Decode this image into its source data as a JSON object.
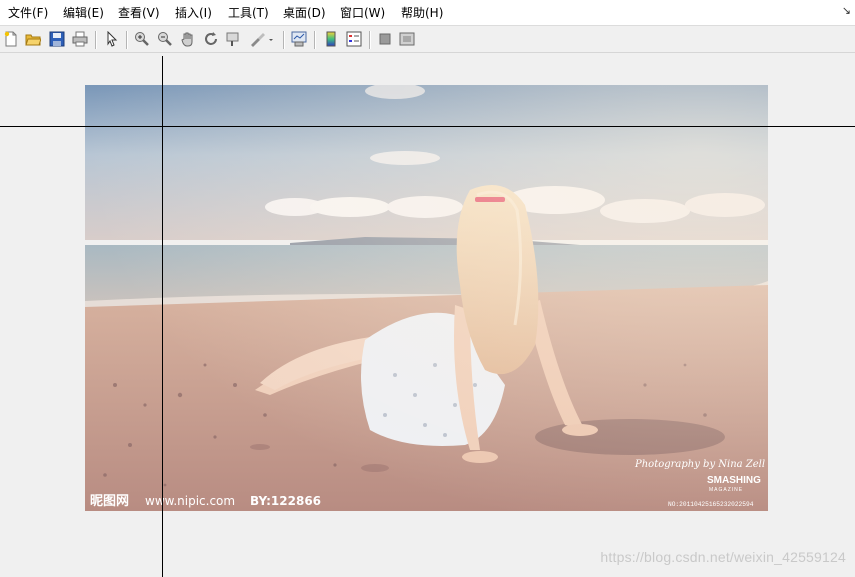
{
  "menubar": {
    "items": [
      "文件(F)",
      "编辑(E)",
      "查看(V)",
      "插入(I)",
      "工具(T)",
      "桌面(D)",
      "窗口(W)",
      "帮助(H)"
    ],
    "corner_glyph": "↘"
  },
  "toolbar": {
    "icons": [
      "new-document-icon",
      "open-folder-icon",
      "save-icon",
      "print-icon",
      "pointer-icon",
      "zoom-in-icon",
      "zoom-out-icon",
      "pan-hand-icon",
      "rotate-icon",
      "data-cursor-icon",
      "brush-icon",
      "link-plot-icon",
      "colorbar-icon",
      "legend-icon",
      "hide-plot-tools-icon",
      "show-plot-tools-icon"
    ]
  },
  "photo": {
    "signature": "Photography by Nina Zell",
    "brand_line1": "SMASHING",
    "brand_line2": "MAGAZINE",
    "site_name": "昵图网",
    "site_url": "www.nipic.com",
    "by_text": "BY:122866",
    "serial_text": "NO:20110425165232022594"
  },
  "watermark": "https://blog.csdn.net/weixin_42559124"
}
